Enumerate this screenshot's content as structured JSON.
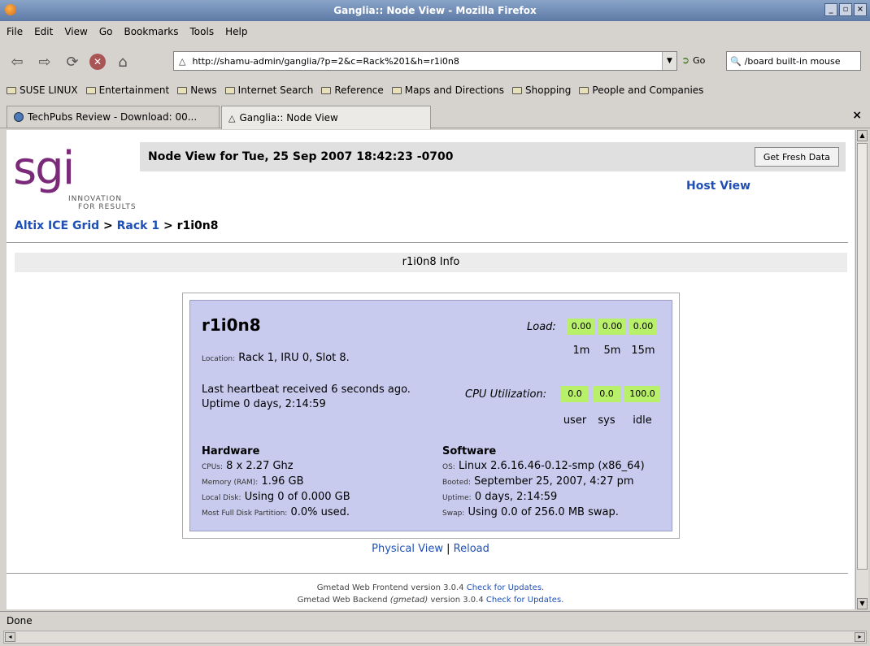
{
  "window": {
    "title": "Ganglia:: Node View - Mozilla Firefox",
    "controls": [
      "_",
      "▫",
      "×"
    ]
  },
  "menu": [
    "File",
    "Edit",
    "View",
    "Go",
    "Bookmarks",
    "Tools",
    "Help"
  ],
  "toolbar": {
    "url": "http://shamu-admin/ganglia/?p=2&c=Rack%201&h=r1i0n8",
    "go_label": "Go",
    "search_text": "/board built-in mouse"
  },
  "bookmarks": [
    "SUSE LINUX",
    "Entertainment",
    "News",
    "Internet Search",
    "Reference",
    "Maps and Directions",
    "Shopping",
    "People and Companies"
  ],
  "tabs": [
    {
      "label": "TechPubs Review - Download: 00..."
    },
    {
      "label": "Ganglia:: Node View"
    }
  ],
  "page": {
    "logo_tagline_1": "INNOVATION",
    "logo_tagline_2": "FOR RESULTS",
    "logo_text": "sgi",
    "header": "Node View for Tue, 25 Sep 2007 18:42:23 -0700",
    "fresh_button": "Get Fresh Data",
    "host_view": "Host View",
    "breadcrumb": {
      "grid": "Altix ICE Grid",
      "sep1": " > ",
      "rack": "Rack 1",
      "sep2": " > ",
      "node": "r1i0n8"
    },
    "info_title": "r1i0n8 Info"
  },
  "node": {
    "name": "r1i0n8",
    "location_label": "Location:",
    "location_value": "Rack 1, IRU 0, Slot 8.",
    "heartbeat": "Last heartbeat received 6 seconds ago.",
    "uptime": "Uptime 0 days, 2:14:59",
    "load_label": "Load:",
    "load_values": [
      "0.00",
      "0.00",
      "0.00"
    ],
    "load_periods": [
      "1m",
      "5m",
      "15m"
    ],
    "cpu_label": "CPU Utilization:",
    "cpu_values": [
      "0.0",
      "0.0",
      "100.0"
    ],
    "cpu_types": [
      "user",
      "sys",
      "idle"
    ],
    "hardware": {
      "title": "Hardware",
      "cpus_k": "CPUs:",
      "cpus_v": "8 x 2.27 Ghz",
      "mem_k": "Memory (RAM):",
      "mem_v": "1.96 GB",
      "disk_k": "Local Disk:",
      "disk_v": "Using 0 of 0.000 GB",
      "part_k": "Most Full Disk Partition:",
      "part_v": "0.0% used."
    },
    "software": {
      "title": "Software",
      "os_k": "OS:",
      "os_v": "Linux 2.6.16.46-0.12-smp (x86_64)",
      "boot_k": "Booted:",
      "boot_v": "September 25, 2007, 4:27 pm",
      "up_k": "Uptime:",
      "up_v": "0 days, 2:14:59",
      "swap_k": "Swap:",
      "swap_v": "Using 0.0 of 256.0 MB swap."
    }
  },
  "links": {
    "physical": "Physical View",
    "sep": " | ",
    "reload": "Reload"
  },
  "footer": {
    "frontend": "Gmetad Web Frontend version 3.0.4",
    "backend_pre": "Gmetad Web Backend",
    "backend_name": "(gmetad)",
    "backend_post": "version 3.0.4",
    "updates": "Check for Updates."
  },
  "status": "Done"
}
